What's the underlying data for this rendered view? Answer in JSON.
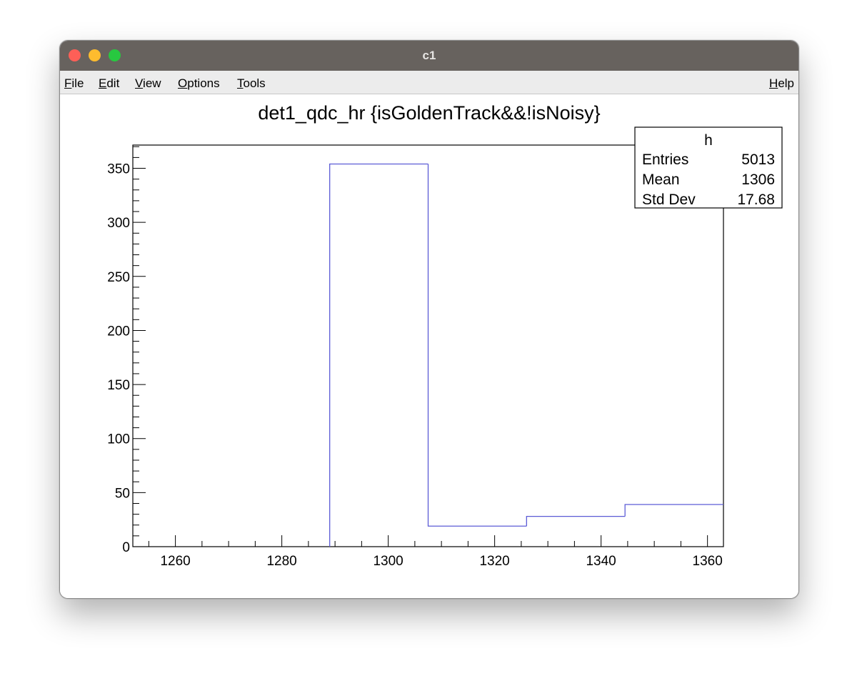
{
  "window": {
    "title": "c1"
  },
  "menu": {
    "file": "File",
    "edit": "Edit",
    "view": "View",
    "options": "Options",
    "tools": "Tools",
    "help": "Help"
  },
  "stats": {
    "name": "h",
    "rows": [
      {
        "label": "Entries",
        "value": "5013"
      },
      {
        "label": "Mean",
        "value": "1306"
      },
      {
        "label": "Std Dev",
        "value": "17.68"
      }
    ]
  },
  "chart_data": {
    "type": "bar",
    "title": "det1_qdc_hr {isGoldenTrack&&!isNoisy}",
    "xlabel": "",
    "ylabel": "",
    "xlim": [
      1252,
      1363
    ],
    "ylim": [
      0,
      371.5
    ],
    "bins": [
      {
        "x0": 1289,
        "x1": 1307.5,
        "value": 354
      },
      {
        "x0": 1307.5,
        "x1": 1326,
        "value": 19
      },
      {
        "x0": 1326,
        "x1": 1344.5,
        "value": 28
      },
      {
        "x0": 1344.5,
        "x1": 1363,
        "value": 39
      }
    ],
    "xticks": [
      1260,
      1280,
      1300,
      1320,
      1340,
      1360
    ],
    "xtick_labels": [
      "1260",
      "1280",
      "1300",
      "1320",
      "1340",
      "1360"
    ],
    "yticks": [
      0,
      50,
      100,
      150,
      200,
      250,
      300,
      350
    ],
    "ytick_labels": [
      "0",
      "50",
      "100",
      "150",
      "200",
      "250",
      "300",
      "350"
    ],
    "line_color": "#5c5cd6",
    "grid": false,
    "legend": "top-right"
  }
}
